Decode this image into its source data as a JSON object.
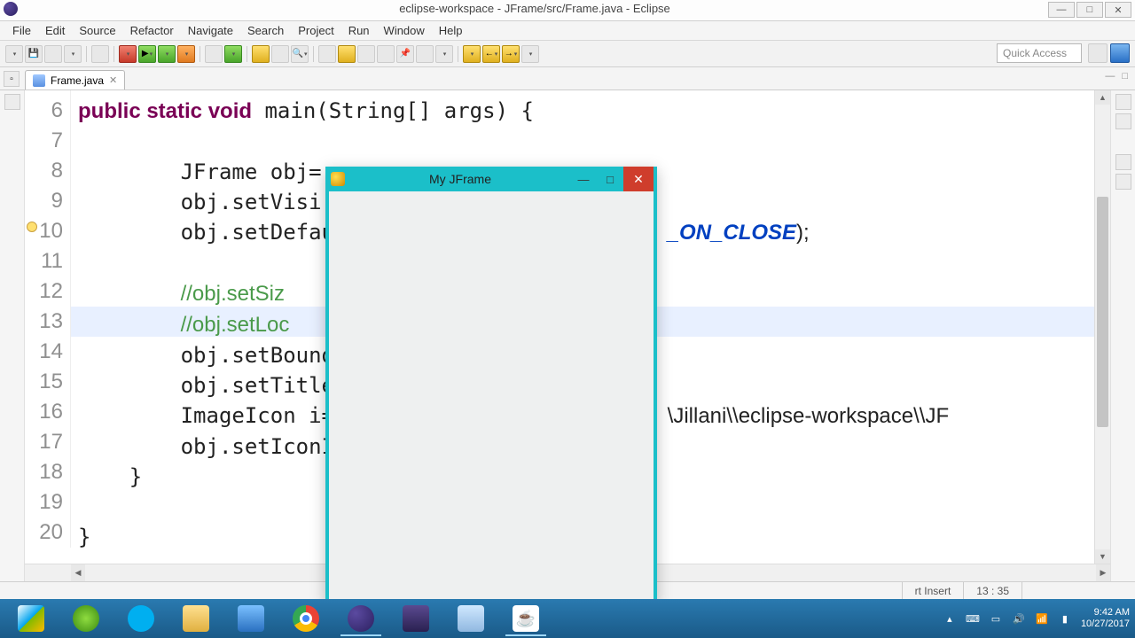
{
  "window": {
    "title": "eclipse-workspace - JFrame/src/Frame.java - Eclipse"
  },
  "menu": {
    "file": "File",
    "edit": "Edit",
    "source": "Source",
    "refactor": "Refactor",
    "navigate": "Navigate",
    "search": "Search",
    "project": "Project",
    "run": "Run",
    "window": "Window",
    "help": "Help"
  },
  "toolbar": {
    "quick_access_placeholder": "Quick Access"
  },
  "tab": {
    "filename": "Frame.java"
  },
  "editor": {
    "line_start": 6,
    "highlighted_line": 13,
    "marker_line": 10,
    "lines": [
      {
        "n": 6,
        "pre": "    ",
        "kw": "public static void",
        "plain": " main(String[] args) {"
      },
      {
        "n": 7,
        "pre": "",
        "kw": "",
        "plain": ""
      },
      {
        "n": 8,
        "pre": "        ",
        "kw": "",
        "plain": "JFrame obj="
      },
      {
        "n": 9,
        "pre": "        ",
        "kw": "",
        "plain": "obj.setVisi"
      },
      {
        "n": 10,
        "pre": "        ",
        "kw": "",
        "plain": "obj.setDefau",
        "tail_ital": "_ON_CLOSE",
        "tail_plain": ");"
      },
      {
        "n": 11,
        "pre": "",
        "kw": "",
        "plain": ""
      },
      {
        "n": 12,
        "pre": "        ",
        "cmnt": "//obj.setSiz"
      },
      {
        "n": 13,
        "pre": "        ",
        "cmnt": "//obj.setLoc"
      },
      {
        "n": 14,
        "pre": "        ",
        "kw": "",
        "plain": "obj.setBound"
      },
      {
        "n": 15,
        "pre": "        ",
        "kw": "",
        "plain": "obj.setTitle"
      },
      {
        "n": 16,
        "pre": "        ",
        "kw": "",
        "plain": "ImageIcon i=",
        "tail_plain": "\\Jillani\\\\eclipse-workspace\\\\JF"
      },
      {
        "n": 17,
        "pre": "        ",
        "kw": "",
        "plain": "obj.setIconI"
      },
      {
        "n": 18,
        "pre": "    ",
        "kw": "",
        "plain": "}"
      },
      {
        "n": 19,
        "pre": "",
        "kw": "",
        "plain": ""
      },
      {
        "n": 20,
        "pre": "",
        "kw": "",
        "plain": "}"
      }
    ]
  },
  "status": {
    "insert": "rt Insert",
    "pos": "13 : 35"
  },
  "jframe": {
    "title": "My JFrame"
  },
  "tray": {
    "time": "9:42 AM",
    "date": "10/27/2017"
  }
}
